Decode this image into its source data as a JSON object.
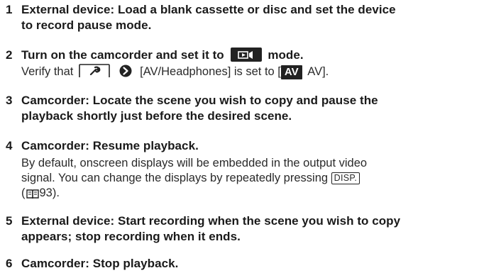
{
  "steps": [
    {
      "number": "1",
      "heading_line1": "External device: Load a blank cassette or disc and set the device",
      "heading_line2": "to record pause mode."
    },
    {
      "number": "2",
      "heading_pre": "Turn on the camcorder and set it to",
      "heading_post": "mode.",
      "body_pre": "Verify that",
      "body_menu": "[AV/Headphones] is set to [",
      "body_badge": "AV",
      "body_post": " AV]."
    },
    {
      "number": "3",
      "heading_line1": "Camcorder: Locate the scene you wish to copy and pause the",
      "heading_line2": "playback shortly just before the desired scene."
    },
    {
      "number": "4",
      "heading_line1": "Camcorder: Resume playback.",
      "body_line1": "By default, onscreen displays will be embedded in the output video",
      "body_line2_pre": "signal. You can change the displays by repeatedly pressing",
      "body_key": "DISP.",
      "body_line3": "( 📖 93).",
      "body_line3_num": "93"
    },
    {
      "number": "5",
      "heading_line1": "External device: Start recording when the scene you wish to copy",
      "heading_line2": "appears; stop recording when it ends."
    },
    {
      "number": "6",
      "heading_line1": "Camcorder: Stop playback."
    }
  ],
  "icons": {
    "playback_mode": "playback-mode-icon",
    "setup_tab": "wrench-tab-icon",
    "menu_chevron": "chevron-right-icon",
    "manual_reference": "book-icon"
  }
}
